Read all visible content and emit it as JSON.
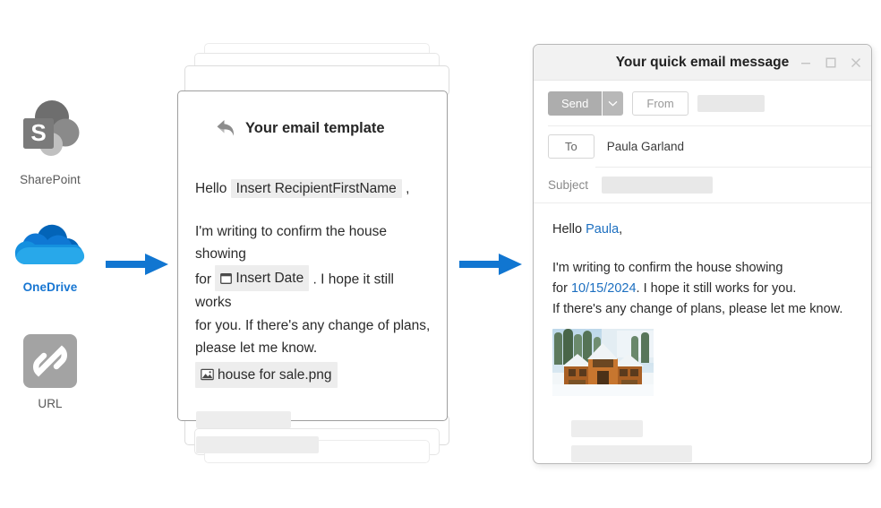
{
  "sources": [
    {
      "id": "sharepoint",
      "label": "SharePoint",
      "icon": "sharepoint-logo-icon",
      "brand": false
    },
    {
      "id": "onedrive",
      "label": "OneDrive",
      "icon": "onedrive-cloud-icon",
      "brand": true
    },
    {
      "id": "url",
      "label": "URL",
      "icon": "link-chain-icon",
      "brand": false
    }
  ],
  "arrows": {
    "first": {
      "name": "flow-arrow-sources-to-template",
      "color": "#1176d1"
    },
    "second": {
      "name": "flow-arrow-template-to-email",
      "color": "#1176d1"
    }
  },
  "template": {
    "icon": "reply-arrow-icon",
    "title": "Your email template",
    "greeting_prefix": "Hello",
    "recipient_placeholder": "Insert RecipientFirstName",
    "greeting_suffix": ",",
    "body_line_1": "I'm writing to confirm the house showing",
    "body_line_2_prefix": "for",
    "date_placeholder": "Insert Date",
    "date_icon": "calendar-icon",
    "body_line_2_suffix": ". I hope it still works",
    "body_line_3": "for you. If there's any change of plans,",
    "body_line_4": "please let me know.",
    "attachment_icon": "image-icon",
    "attachment_name": "house for sale.png"
  },
  "email": {
    "title": "Your quick email message",
    "window_controls": {
      "minimize": "minimize-icon",
      "maximize": "maximize-icon",
      "close": "close-icon"
    },
    "toolbar": {
      "send_label": "Send",
      "send_dropdown_icon": "chevron-down-icon",
      "from_label": "From",
      "from_value": ""
    },
    "to_label": "To",
    "to_value": "Paula Garland",
    "subject_label": "Subject",
    "subject_value": "",
    "body": {
      "greeting_prefix": "Hello",
      "recipient_name": "Paula",
      "greeting_suffix": ",",
      "line_1": "I'm writing to confirm the house showing",
      "line_2_prefix": "for",
      "date_value": "10/15/2024",
      "line_2_suffix": ". I hope it still works for you.",
      "line_3": "If there's any change of plans, please let me know.",
      "image_alt": "house-for-sale-photo"
    }
  },
  "colors": {
    "accent_blue": "#1176d1",
    "link_blue": "#1c6fc0",
    "onedrive_blue": "#1776d2",
    "muted_gray": "#8a8a8a",
    "skeleton_gray": "#ededed"
  }
}
